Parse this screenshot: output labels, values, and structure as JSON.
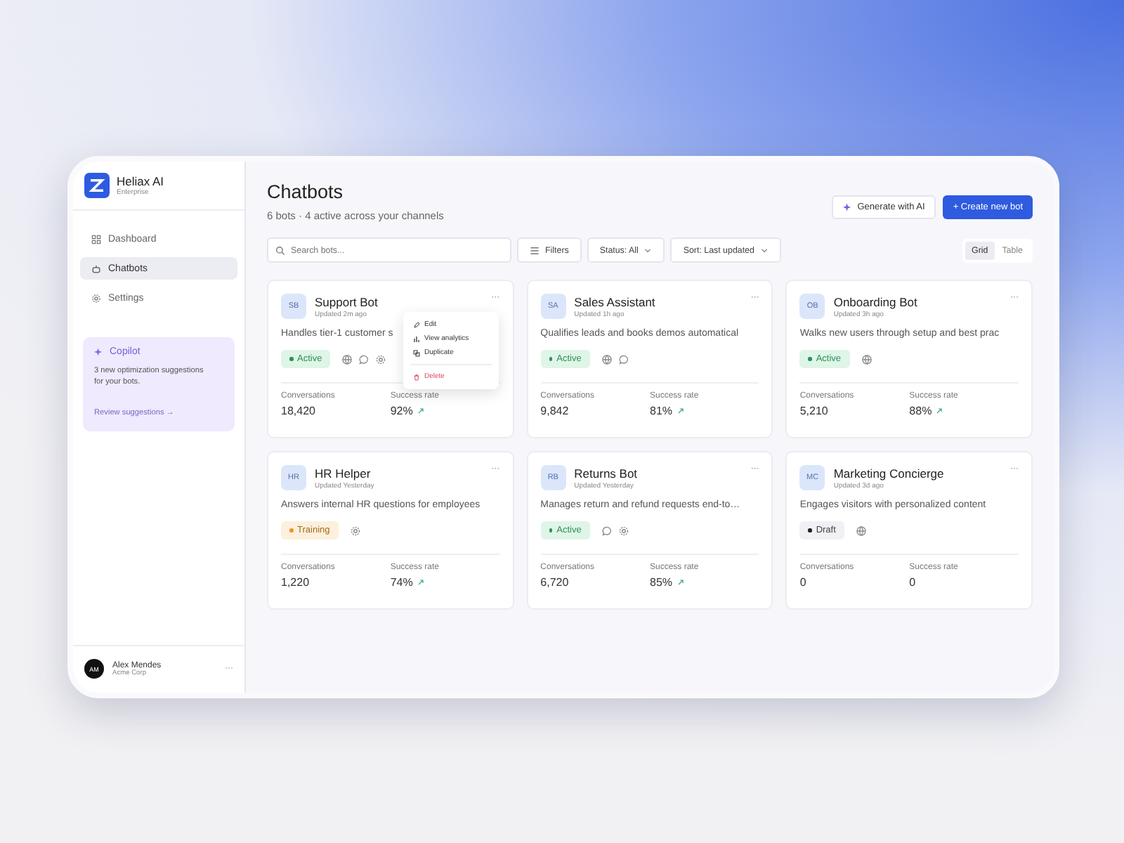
{
  "brand": {
    "name": "Heliax AI",
    "plan": "Enterprise"
  },
  "nav": [
    {
      "label": "Dashboard",
      "kind": "grid",
      "selected": false
    },
    {
      "label": "Chatbots",
      "kind": "bot",
      "selected": true
    },
    {
      "label": "Settings",
      "kind": "gear",
      "selected": false
    }
  ],
  "copilot": {
    "title": "Copilot",
    "text": "3 new optimization suggestions for your bots.",
    "link": "Review suggestions",
    "link_arrow": "→"
  },
  "user": {
    "initials": "AM",
    "name": "Alex Mendes",
    "org": "Acme Corp",
    "more": "···"
  },
  "header": {
    "title": "Chatbots",
    "subtitle": "6 bots · 4 active across your channels",
    "generate": "Generate with AI",
    "create_plus": "+",
    "create": "Create new bot"
  },
  "toolbar": {
    "search_placeholder": "Search bots...",
    "filters": "Filters",
    "status": "Status: All",
    "sort": "Sort: Last updated",
    "views": [
      {
        "label": "Grid",
        "selected": true
      },
      {
        "label": "Table",
        "selected": false
      }
    ]
  },
  "bots": [
    {
      "initials": "SB",
      "name": "Support Bot",
      "updated": "Updated 2m ago",
      "description": "Handles tier-1 customer s",
      "status": {
        "kind": "active",
        "label": "Active"
      },
      "channels": [
        {
          "kind": "web"
        },
        {
          "kind": "chat"
        },
        {
          "kind": "api"
        }
      ],
      "conversations": "18,420",
      "success": "92%",
      "trend_up": true,
      "more": "···",
      "conversations_label": "Conversations",
      "success_label": "Success rate",
      "menu": [
        {
          "kind": "edit",
          "label": "Edit"
        },
        {
          "kind": "analytics",
          "label": "View analytics"
        },
        {
          "kind": "duplicate",
          "label": "Duplicate"
        },
        {
          "kind": "delete",
          "label": "Delete"
        }
      ]
    },
    {
      "initials": "SA",
      "name": "Sales Assistant",
      "updated": "Updated 1h ago",
      "description": "Qualifies leads and books demos automatical",
      "status": {
        "kind": "active",
        "label": "Active"
      },
      "channels": [
        {
          "kind": "web"
        },
        {
          "kind": "chat"
        }
      ],
      "conversations": "9,842",
      "success": "81%",
      "trend_up": true,
      "more": "···",
      "conversations_label": "Conversations",
      "success_label": "Success rate"
    },
    {
      "initials": "OB",
      "name": "Onboarding Bot",
      "updated": "Updated 3h ago",
      "description": "Walks new users through setup and best prac",
      "status": {
        "kind": "active",
        "label": "Active"
      },
      "channels": [
        {
          "kind": "web"
        }
      ],
      "conversations": "5,210",
      "success": "88%",
      "trend_up": true,
      "more": "···",
      "conversations_label": "Conversations",
      "success_label": "Success rate"
    },
    {
      "initials": "HR",
      "name": "HR Helper",
      "updated": "Updated Yesterday",
      "description": "Answers internal HR questions for employees",
      "status": {
        "kind": "training",
        "label": "Training"
      },
      "channels": [
        {
          "kind": "api"
        }
      ],
      "conversations": "1,220",
      "success": "74%",
      "trend_up": true,
      "more": "···",
      "conversations_label": "Conversations",
      "success_label": "Success rate"
    },
    {
      "initials": "RB",
      "name": "Returns Bot",
      "updated": "Updated Yesterday",
      "description": "Manages return and refund requests end-to…",
      "status": {
        "kind": "active",
        "label": "Active"
      },
      "channels": [
        {
          "kind": "chat"
        },
        {
          "kind": "api"
        }
      ],
      "conversations": "6,720",
      "success": "85%",
      "trend_up": true,
      "more": "···",
      "conversations_label": "Conversations",
      "success_label": "Success rate"
    },
    {
      "initials": "MC",
      "name": "Marketing Concierge",
      "updated": "Updated 3d ago",
      "description": "Engages visitors with personalized content",
      "status": {
        "kind": "draft",
        "label": "Draft"
      },
      "channels": [
        {
          "kind": "web"
        }
      ],
      "conversations": "0",
      "success": "0",
      "trend_up": false,
      "more": "···",
      "conversations_label": "Conversations",
      "success_label": "Success rate"
    }
  ]
}
